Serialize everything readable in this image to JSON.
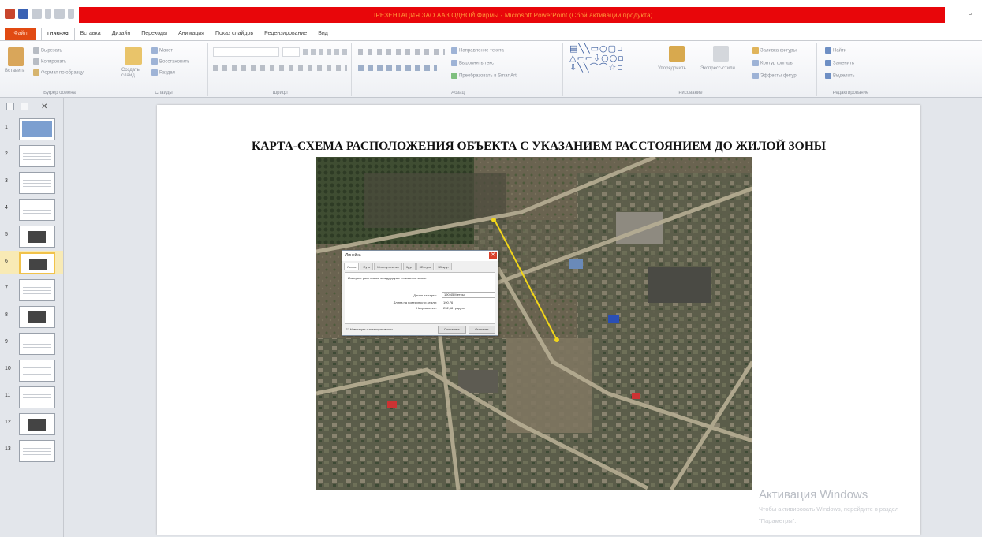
{
  "window": {
    "title": "ПРЕЗЕНТАЦИЯ ЗАО ААЗ ОДНОЙ Фирмы - Microsoft PowerPoint (Сбой активации продукта)"
  },
  "tabs": [
    {
      "label": "Файл"
    },
    {
      "label": "Главная"
    },
    {
      "label": "Вставка"
    },
    {
      "label": "Дизайн"
    },
    {
      "label": "Переходы"
    },
    {
      "label": "Анимация"
    },
    {
      "label": "Показ слайдов"
    },
    {
      "label": "Рецензирование"
    },
    {
      "label": "Вид"
    }
  ],
  "ribbon": {
    "clipboard": {
      "label": "Буфер обмена",
      "paste": "Вставить",
      "cut": "Вырезать",
      "copy": "Копировать",
      "format_painter": "Формат по образцу"
    },
    "slides": {
      "label": "Слайды",
      "new_slide": "Создать слайд",
      "layout": "Макет",
      "reset": "Восстановить",
      "section": "Раздел"
    },
    "font": {
      "label": "Шрифт"
    },
    "paragraph": {
      "label": "Абзац",
      "text_direction": "Направление текста",
      "align_text": "Выровнять текст",
      "smartart": "Преобразовать в SmartArt"
    },
    "drawing": {
      "label": "Рисование",
      "arrange": "Упорядочить",
      "quick_styles": "Экспресс-стили",
      "shape_fill": "Заливка фигуры",
      "shape_outline": "Контур фигуры",
      "shape_effects": "Эффекты фигур"
    },
    "editing": {
      "label": "Редактирование",
      "find": "Найти",
      "replace": "Заменить",
      "select": "Выделить"
    }
  },
  "slides_panel": {
    "selected": 6,
    "items": [
      {
        "num": "1",
        "kind": "blue"
      },
      {
        "num": "2",
        "kind": "text"
      },
      {
        "num": "3",
        "kind": "text"
      },
      {
        "num": "4",
        "kind": "text"
      },
      {
        "num": "5",
        "kind": "image"
      },
      {
        "num": "6",
        "kind": "image"
      },
      {
        "num": "7",
        "kind": "text"
      },
      {
        "num": "8",
        "kind": "image"
      },
      {
        "num": "9",
        "kind": "text"
      },
      {
        "num": "10",
        "kind": "text"
      },
      {
        "num": "11",
        "kind": "text"
      },
      {
        "num": "12",
        "kind": "image"
      },
      {
        "num": "13",
        "kind": "text"
      }
    ]
  },
  "slide": {
    "title": "КАРТА-СХЕМА РАСПОЛОЖЕНИЯ ОБЪЕКТА С УКАЗАНИЕМ РАССТОЯНИЕМ ДО ЖИЛОЙ ЗОНЫ"
  },
  "ruler_dialog": {
    "title": "Линейка",
    "tabs": [
      "Линия",
      "Путь",
      "Многоугольник",
      "Круг",
      "3D-путь",
      "3D-круг"
    ],
    "instruction": "Измерьте расстояние между двумя точками на земле",
    "rows": [
      {
        "label": "Длина на карте:",
        "value": "190,45 Метры"
      },
      {
        "label": "Длина на поверхности земли:",
        "value": "190,76"
      },
      {
        "label": "Направление:",
        "value": "232,68 градуса"
      }
    ],
    "checkbox": "Навигация с помощью мыши",
    "save_button": "Сохранить",
    "clear_button": "Очистить"
  },
  "activation": {
    "title": "Активация Windows",
    "line1": "Чтобы активировать Windows, перейдите в раздел",
    "line2": "\"Параметры\"."
  },
  "colors": {
    "title_bar": "#e8060a",
    "file_tab": "#e14a12",
    "selected_thumb": "#f1c24a"
  }
}
